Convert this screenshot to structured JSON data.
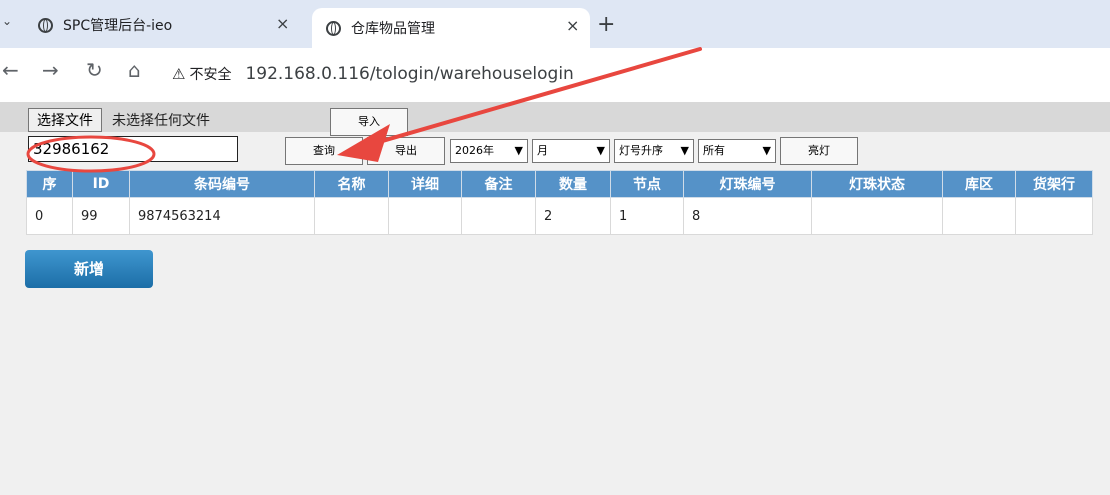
{
  "browser": {
    "tabs": [
      {
        "title": "SPC管理后台-ieo",
        "close": "×"
      },
      {
        "title": "仓库物品管理",
        "close": "×"
      }
    ],
    "new_tab": "+",
    "nav": {
      "back": "←",
      "forward": "→",
      "reload": "↻",
      "home": "⌂"
    },
    "security_icon": "⚠",
    "security_label": "不安全",
    "url": "192.168.0.116/tologin/warehouselogin"
  },
  "toolbar": {
    "choose_file": "选择文件",
    "file_status": "未选择任何文件",
    "import": "导入",
    "search_value": "32986162",
    "query": "查询",
    "export": "导出",
    "year": "2026年",
    "month": "月",
    "sort": "灯号升序",
    "filter": "所有",
    "light": "亮灯"
  },
  "table": {
    "headers": [
      "序",
      "ID",
      "条码编号",
      "名称",
      "详细",
      "备注",
      "数量",
      "节点",
      "灯珠编号",
      "灯珠状态",
      "库区",
      "货架行"
    ],
    "rows": [
      [
        "0",
        "99",
        "9874563214",
        "",
        "",
        "",
        "2",
        "1",
        "8",
        "",
        "",
        ""
      ]
    ]
  },
  "actions": {
    "add": "新增"
  },
  "annotation_color": "#e8473f"
}
